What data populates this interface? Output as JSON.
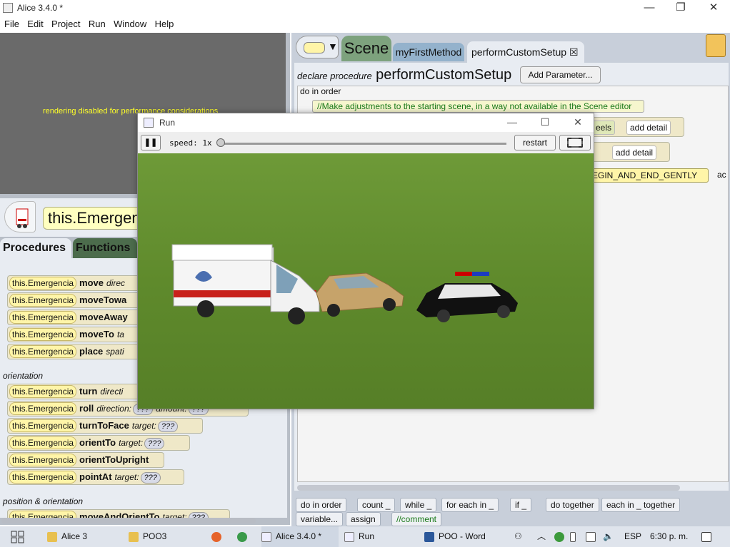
{
  "window": {
    "title": "Alice 3.4.0  *",
    "minimize": "—",
    "maximize": "❐",
    "close": "✕"
  },
  "menu": [
    "File",
    "Edit",
    "Project",
    "Run",
    "Window",
    "Help"
  ],
  "preview": {
    "message": "rendering disabled for performance considerations"
  },
  "selected_object": {
    "name": "this.Emergencia"
  },
  "left_tabs": {
    "procedures": "Procedures",
    "functions": "Functions"
  },
  "tiles": [
    {
      "obj": "this.Emergencia",
      "method": "move",
      "args": "direc"
    },
    {
      "obj": "this.Emergencia",
      "method": "moveTowa",
      "args": ""
    },
    {
      "obj": "this.Emergencia",
      "method": "moveAway",
      "args": ""
    },
    {
      "obj": "this.Emergencia",
      "method": "moveTo",
      "args": "ta"
    },
    {
      "obj": "this.Emergencia",
      "method": "place",
      "args": "spati"
    },
    {
      "obj": "this.Emergencia",
      "method": "turn",
      "args": "directi"
    },
    {
      "obj": "this.Emergencia",
      "method": "roll",
      "args": "direction:",
      "q1": "???",
      "arg2": "amount:",
      "q2": "???"
    },
    {
      "obj": "this.Emergencia",
      "method": "turnToFace",
      "args": "target:",
      "q1": "???"
    },
    {
      "obj": "this.Emergencia",
      "method": "orientTo",
      "args": "target:",
      "q1": "???"
    },
    {
      "obj": "this.Emergencia",
      "method": "orientToUpright",
      "args": ""
    },
    {
      "obj": "this.Emergencia",
      "method": "pointAt",
      "args": "target:",
      "q1": "???"
    },
    {
      "obj": "this.Emergencia",
      "method": "moveAndOrientTo",
      "args": "target:",
      "q1": "???"
    }
  ],
  "categories": {
    "orientation": "orientation",
    "position_orientation": "position & orientation"
  },
  "editor": {
    "type_arrow": "▼",
    "tabs": {
      "scene": "Scene",
      "first": "myFirstMethod",
      "custom": "performCustomSetup",
      "close": "☒"
    },
    "declare_label": "declare procedure",
    "method_name": "performCustomSetup",
    "add_parameter": "Add Parameter...",
    "do_in_order": "do in order",
    "comment": "//Make adjustments to the starting scene, in a way not available in the Scene editor",
    "stmt1_tail": "eels",
    "add_detail": "add detail",
    "animation_style": "EGIN_AND_END_GENTLY",
    "trailing": "ac"
  },
  "controls": [
    "do in order",
    "count _",
    "while _",
    "for each in _",
    "if _",
    "do together",
    "each in _ together",
    "variable...",
    "assign",
    "//comment"
  ],
  "run_window": {
    "title": "Run",
    "pause": "❚❚",
    "speed": "speed: 1x",
    "restart": "restart"
  },
  "taskbar": {
    "items": [
      "Alice 3",
      "POO3",
      "Alice 3.4.0  *",
      "Run",
      "POO - Word"
    ],
    "lang": "ESP",
    "time": "6:30 p. m."
  },
  "colors": {
    "grass": "#5f8a2c",
    "tile": "#efe8c8",
    "pill": "#fff5a8",
    "scene_tab": "#7da27d"
  }
}
